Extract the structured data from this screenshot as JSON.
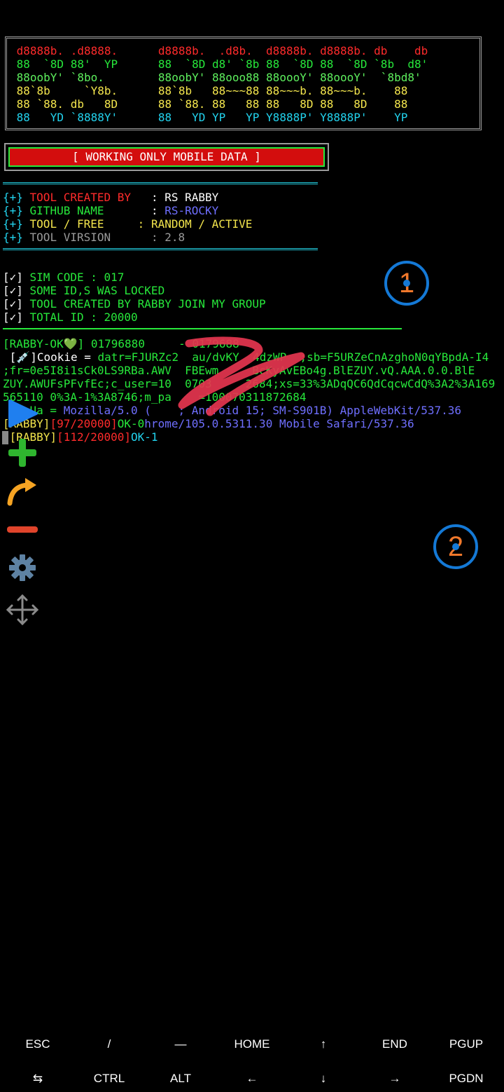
{
  "banner": {
    "rows": [
      {
        "a": " d8888b. .d8888.      ",
        "b": "d8888b.  .d8b.  d8888b. d8888b. db    db"
      },
      {
        "a": " 88  `8D 88'  YP      ",
        "b": "88  `8D d8' `8b 88  `8D 88  `8D `8b  d8'"
      },
      {
        "a": " 88oobY' `8bo.        ",
        "b": "88oobY' 88ooo88 88oooY' 88oooY'  `8bd8' "
      },
      {
        "a": " 88`8b     `Y8b.      ",
        "b": "88`8b   88~~~88 88~~~b. 88~~~b.    88   "
      },
      {
        "a": " 88 `88. db   8D      ",
        "b": "88 `88. 88   88 88   8D 88   8D    88   "
      },
      {
        "a": " 88   YD `8888Y'      ",
        "b": "88   YD YP   YP Y8888P' Y8888P'    YP   "
      }
    ]
  },
  "notice": "[ WORKING ONLY MOBILE DATA ]",
  "info": [
    {
      "prefix": "{+}",
      "label": " TOOL CREATED BY   ",
      "sep": ": ",
      "value": "RS RABBY"
    },
    {
      "prefix": "{+}",
      "label": " GITHUB NAME       ",
      "sep": ": ",
      "value": "RS-ROCKY"
    },
    {
      "prefix": "{+}",
      "label": " TOOL / FREE     ",
      "sep": ": ",
      "value": "RANDOM / ACTIVE"
    },
    {
      "prefix": "{+}",
      "label": " TOOL VIRSION      ",
      "sep": ": ",
      "value": "2.8"
    }
  ],
  "checks": [
    {
      "box": "[✓]",
      "text": " SIM CODE : 017"
    },
    {
      "box": "[✓]",
      "text": " SOME ID,S WAS LOCKED"
    },
    {
      "box": "[✓]",
      "text": " TOOL CREATED BY RABBY JOIN MY GROUP"
    },
    {
      "box": "[✓]",
      "text": " TOTAL ID : 20000"
    }
  ],
  "output": {
    "ok_line": "[RABBY-OK💚] 01796880     - 0179688",
    "cookie_prefix": " [💉]Cookie = ",
    "cookie_1": "datr=FJURZc2  au/dvKY  4dzWP  ;sb=F5URZeCnAzghoN0qYBpdA-I4",
    "cookie_2": ";fr=0e5I8i1sCk0LS9RBa.AWV  FBEwm     BcKyAvEBo4g.BlEZUY.vQ.AAA.0.0.BlE",
    "cookie_3": "ZUY.AWUFsPFvfEc;c_user=10  0703     2684;xs=33%3ADqQC6QdCqcwCdQ%3A2%3A169",
    "cookie_4": "565110 0%3A-1%3A8746;m_pa    =100070311872684",
    "ua_prefix": "    Ua = ",
    "ua_text": "Mozilla/5.0 (    ; Android 15; SM-S901B) AppleWebKit/537.36",
    "progress_1_a": "[RABBY]",
    "progress_1_b": "[97/20000]",
    "progress_1_c": "OK-0",
    "progress_1_d": "hrome/105.0.5311.30 Mobile Safari/537.36",
    "progress_2_a": " [RABBY]",
    "progress_2_b": "[112/20000]",
    "progress_2_c": "OK-1"
  },
  "markers": {
    "one": "1",
    "two": "2"
  },
  "extra_keys": {
    "row1": [
      "ESC",
      "/",
      "—",
      "HOME",
      "↑",
      "END",
      "PGUP"
    ],
    "row2": [
      "⇆",
      "CTRL",
      "ALT",
      "←",
      "↓",
      "→",
      "PGDN"
    ]
  },
  "colors": {
    "accent_red": "#d30d0d",
    "marker_blue": "#1479d6",
    "marker_orange": "#f0782b"
  }
}
